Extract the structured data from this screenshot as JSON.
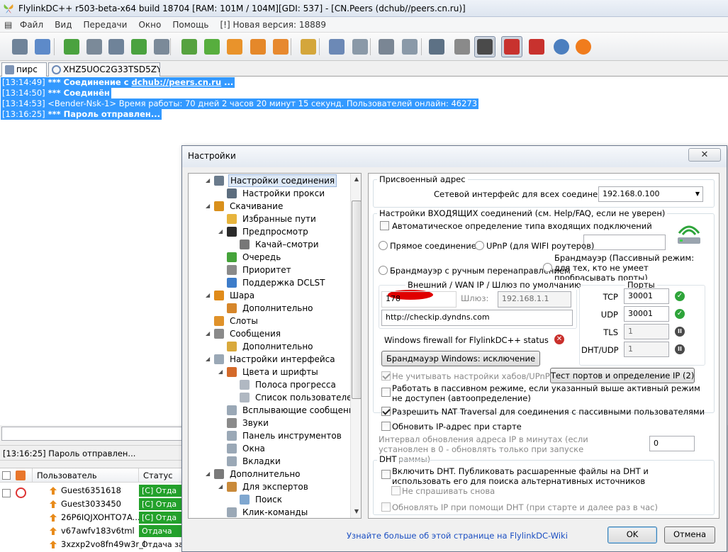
{
  "window": {
    "title": "FlylinkDC++ r503-beta-x64 build 18704 [RAM: 101M / 104M][GDI: 537] - [CN.Peers (dchub//peers.cn.ru)]"
  },
  "menu": [
    "Файл",
    "Вид",
    "Передачи",
    "Окно",
    "Помощь",
    "[!] Новая версия: 18889"
  ],
  "toolbar": {
    "icons": [
      "public-hubs",
      "favorite-hubs",
      "favorite-users",
      "recent-hubs",
      "download-queue",
      "finished-downloads",
      "upload-queue",
      "notepad",
      "arrow-down",
      "download",
      "upload",
      "upload-tray",
      "settings-file",
      "search",
      "adl-search",
      "network-stats",
      "finished-uploads",
      "spy",
      "scheduler",
      "away",
      "limiter",
      "limiter-pressed",
      "media",
      "rss",
      "globe"
    ]
  },
  "tabs": [
    {
      "label": "пирс",
      "active": true
    },
    {
      "label": "XHZ5UOC2G33TSD5ZYH..."
    }
  ],
  "chat": {
    "lines": [
      {
        "time": "[13:14:49]",
        "text": " *** Соединение с ",
        "link": "dchub://peers.cn.ru",
        "suffix": " ..."
      },
      {
        "time": "[13:14:50]",
        "text": " *** Соединён"
      },
      {
        "time": "[13:14:53]",
        "text": " <Bender-Nsk-1> Время работы: 70 дней 2 часов 20 минут 15 секунд. Пользователей онлайн: 46273"
      },
      {
        "time": "[13:16:25]",
        "text": " *** Пароль отправлен..."
      }
    ]
  },
  "status": {
    "text": "[13:16:25] Пароль отправлен..."
  },
  "userlist": {
    "col_user": "Пользователь",
    "col_status": "Статус",
    "users": [
      {
        "name": "Guest6351618",
        "status": "[C] Отда"
      },
      {
        "name": "Guest3033450",
        "status": "[C] Отда"
      },
      {
        "name": "26P6IQJXOHTO7A...",
        "status": "[C] Отда"
      },
      {
        "name": "v67awfv183v6tml",
        "status": "Отдача"
      },
      {
        "name": "3xzxp2vo8fn49w3r_l",
        "status": "Отдача зав"
      }
    ]
  },
  "dialog": {
    "title": "Настройки",
    "close": "✕",
    "tree": [
      {
        "label": "Настройки соединения",
        "level": 0,
        "expanded": true,
        "selected": true,
        "icon": "network-icon",
        "color": "#6a7b8c"
      },
      {
        "label": "Настройки прокси",
        "level": 1,
        "icon": "proxy-icon",
        "color": "#5c6d7e"
      },
      {
        "label": "Скачивание",
        "level": 0,
        "expanded": true,
        "icon": "download-icon",
        "color": "#d9901c"
      },
      {
        "label": "Избранные пути",
        "level": 1,
        "icon": "folder-icon",
        "color": "#e7b43c"
      },
      {
        "label": "Предпросмотр",
        "level": 1,
        "expanded": true,
        "icon": "film-icon",
        "color": "#2b2b2b"
      },
      {
        "label": "Качай–смотри",
        "level": 2,
        "icon": "film-strip-icon",
        "color": "#777"
      },
      {
        "label": "Очередь",
        "level": 1,
        "icon": "queue-icon",
        "color": "#45a33a"
      },
      {
        "label": "Приоритет",
        "level": 1,
        "icon": "priority-icon",
        "color": "#8a8a8a"
      },
      {
        "label": "Поддержка DCLST",
        "level": 1,
        "icon": "dclst-icon",
        "color": "#3d7cc9"
      },
      {
        "label": "Шара",
        "level": 0,
        "expanded": true,
        "icon": "share-icon",
        "color": "#e08b1a"
      },
      {
        "label": "Дополнительно",
        "level": 1,
        "icon": "share-advanced-icon",
        "color": "#d6862a"
      },
      {
        "label": "Слоты",
        "level": 0,
        "icon": "slots-icon",
        "color": "#e0922a"
      },
      {
        "label": "Сообщения",
        "level": 0,
        "expanded": true,
        "icon": "messages-icon",
        "color": "#8a8a8a"
      },
      {
        "label": "Дополнительно",
        "level": 1,
        "icon": "messages-advanced-icon",
        "color": "#d9a93c"
      },
      {
        "label": "Настройки интерфейса",
        "level": 0,
        "expanded": true,
        "icon": "window-icon",
        "color": "#9aa8b6"
      },
      {
        "label": "Цвета и шрифты",
        "level": 1,
        "expanded": true,
        "icon": "palette-icon",
        "color": "#d46a2a"
      },
      {
        "label": "Полоса прогресса",
        "level": 2,
        "icon": "progress-icon",
        "color": "#b0b8c2"
      },
      {
        "label": "Список пользователей",
        "level": 2,
        "icon": "userlist-icon",
        "color": "#b0b8c2"
      },
      {
        "label": "Всплывающие сообщения",
        "level": 1,
        "icon": "popup-icon",
        "color": "#9aa8b6"
      },
      {
        "label": "Звуки",
        "level": 1,
        "icon": "speaker-icon",
        "color": "#8a8a8a"
      },
      {
        "label": "Панель инструментов",
        "level": 1,
        "icon": "toolbar-icon",
        "color": "#9aa8b6"
      },
      {
        "label": "Окна",
        "level": 1,
        "icon": "windows-icon",
        "color": "#9aa8b6"
      },
      {
        "label": "Вкладки",
        "level": 1,
        "icon": "tabs-icon",
        "color": "#9aa8b6"
      },
      {
        "label": "Дополнительно",
        "level": 0,
        "expanded": true,
        "icon": "tools-icon",
        "color": "#7a7a7a"
      },
      {
        "label": "Для экспертов",
        "level": 1,
        "expanded": true,
        "icon": "expert-icon",
        "color": "#c98a3a"
      },
      {
        "label": "Поиск",
        "level": 2,
        "icon": "search-icon",
        "color": "#7fa7d0"
      },
      {
        "label": "Клик-команды",
        "level": 1,
        "icon": "mouse-icon",
        "color": "#9aa8b6"
      }
    ],
    "assigned": {
      "legend": "Присвоенный адрес",
      "iface_label": "Сетевой интерфейс для всех соединений",
      "iface_value": "192.168.0.100"
    },
    "incoming": {
      "legend": "Настройки ВХОДЯЩИХ соединений (см. Help/FAQ, если не уверен)",
      "auto_detect": "Автоматическое определение типа входящих подключений",
      "direct": "Прямое соединение",
      "upnp": "UPnP (для WIFI роутеров)",
      "passive": "Брандмауэр (Пассивный режим: для тех, кто не умеет пробрасывать порты)",
      "manual": "Брандмауэр с ручным перенаправлением",
      "wan_legend": "Внешний / WAN IP / Шлюз по умолчанию",
      "wan_ip": "178",
      "gateway_label": "Шлюз:",
      "gateway_value": "192.168.1.1",
      "checkip_url": "http://checkip.dyndns.com",
      "ports_legend": "Порты",
      "ports": [
        {
          "label": "TCP",
          "value": "30001",
          "state": "ok"
        },
        {
          "label": "UDP",
          "value": "30001",
          "state": "ok"
        },
        {
          "label": "TLS",
          "value": "1",
          "state": "paused"
        },
        {
          "label": "DHT/UDP",
          "value": "1",
          "state": "paused"
        }
      ],
      "firewall_status": "Windows firewall for FlylinkDC++ status",
      "firewall_btn": "Брандмауэр Windows: исключение",
      "test_btn": "Тест портов и определение IP (2)",
      "ignore_hubs": "Не учитывать настройки хабов/UPnP",
      "passive_fallback": "Работать в пассивном режиме, если указанный выше активный режим не доступен (автоопределение)",
      "nat_traversal": "Разрешить NAT Traversal для соединения с пассивными пользователями"
    },
    "update_ip": {
      "label": "Обновить IP-адрес при старте",
      "interval_label": "Интервал обновления адреса IP в минутах (если установлен в 0 - обновлять только при запуске программы)",
      "interval_value": "0"
    },
    "dht": {
      "legend": "DHT",
      "enable": "Включить DHT. Публиковать расшаренные файлы на DHT и использовать его для поиска альтернативных источников",
      "dont_ask": "Не спрашивать снова",
      "update_ip": "Обновлять IP при помощи DHT (при старте и далее раз в час)"
    },
    "help_link": "Узнайте больше об этой странице на FlylinkDC-Wiki",
    "ok": "OK",
    "cancel": "Отмена"
  }
}
